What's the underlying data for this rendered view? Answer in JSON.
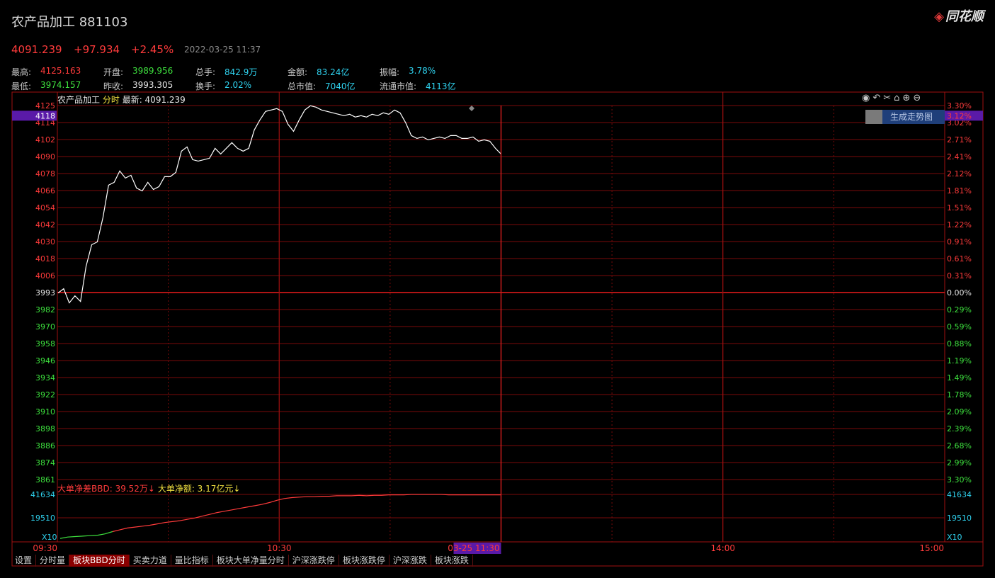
{
  "header": {
    "name": "农产品加工",
    "code": "881103",
    "logo": "同花顺",
    "price": "4091.239",
    "change": "+97.934",
    "pct": "+2.45%",
    "datetime": "2022-03-25 11:37"
  },
  "stats": {
    "high_label": "最高:",
    "high": "4125.163",
    "open_label": "开盘:",
    "open": "3989.956",
    "vol_label": "总手:",
    "vol": "842.9万",
    "amt_label": "金额:",
    "amt": "83.24亿",
    "amp_label": "振幅:",
    "amp": "3.78%",
    "low_label": "最低:",
    "low": "3974.157",
    "prev_label": "昨收:",
    "prev": "3993.305",
    "turn_label": "换手:",
    "turn": "2.02%",
    "mcap_label": "总市值:",
    "mcap": "7040亿",
    "fcap_label": "流通市值:",
    "fcap": "4113亿"
  },
  "chart": {
    "legend_name": "农产品加工",
    "legend_mode": "分时",
    "legend_latest": "最新: 4091.239",
    "cursor_price": "4118",
    "cursor_pct": "3.12%",
    "gen_button": "生成走势图",
    "icons": [
      "eye-icon",
      "undo-icon",
      "scissors-icon",
      "lock-icon",
      "zoom-in-icon",
      "zoom-out-icon"
    ],
    "bbd_label1": "大单净差BBD: 39.52万↓",
    "bbd_label2": "大单净额: 3.17亿元↓",
    "sub_multiplier": "X10",
    "cursor_time": "03-25 11:30"
  },
  "chart_data": {
    "type": "line",
    "title": "农产品加工 分时",
    "prev_close": 3993.305,
    "x_ticks": [
      "09:30",
      "10:30",
      "14:00",
      "15:00"
    ],
    "y_ticks_left": [
      "4125",
      "4114",
      "4102",
      "4090",
      "4078",
      "4066",
      "4054",
      "4042",
      "4030",
      "4018",
      "4006",
      "3993",
      "3982",
      "3970",
      "3958",
      "3946",
      "3934",
      "3922",
      "3910",
      "3898",
      "3886",
      "3874",
      "3861"
    ],
    "y_ticks_right": [
      "3.30%",
      "3.02%",
      "2.71%",
      "2.41%",
      "2.12%",
      "1.81%",
      "1.51%",
      "1.22%",
      "0.91%",
      "0.61%",
      "0.31%",
      "0.00%",
      "0.29%",
      "0.59%",
      "0.88%",
      "1.19%",
      "1.49%",
      "1.78%",
      "2.09%",
      "2.39%",
      "2.68%",
      "2.99%",
      "3.30%"
    ],
    "price_series": [
      3993,
      3996,
      3986,
      3991,
      3987,
      4012,
      4027,
      4029,
      4046,
      4069,
      4071,
      4079,
      4074,
      4076,
      4067,
      4065,
      4071,
      4066,
      4068,
      4075,
      4075,
      4078,
      4093,
      4096,
      4087,
      4086,
      4087,
      4088,
      4095,
      4091,
      4095,
      4099,
      4095,
      4093,
      4095,
      4108,
      4115,
      4121,
      4122,
      4123,
      4121,
      4112,
      4107,
      4115,
      4122,
      4125,
      4124,
      4122,
      4121,
      4120,
      4119,
      4118,
      4119,
      4117,
      4118,
      4117,
      4119,
      4118,
      4120,
      4119,
      4122,
      4120,
      4113,
      4104,
      4102,
      4103,
      4101,
      4102,
      4103,
      4102,
      4104,
      4104,
      4102,
      4102,
      4103,
      4100,
      4101,
      4100,
      4095,
      4091
    ],
    "sub_y_ticks": [
      "41634",
      "19510"
    ],
    "bbd_series": [
      0.03,
      0.06,
      0.07,
      0.08,
      0.09,
      0.1,
      0.13,
      0.18,
      0.22,
      0.26,
      0.28,
      0.3,
      0.32,
      0.35,
      0.38,
      0.4,
      0.42,
      0.45,
      0.48,
      0.52,
      0.56,
      0.6,
      0.63,
      0.66,
      0.69,
      0.72,
      0.75,
      0.78,
      0.82,
      0.87,
      0.91,
      0.93,
      0.94,
      0.95,
      0.95,
      0.96,
      0.96,
      0.97,
      0.97,
      0.97,
      0.98,
      0.97,
      0.98,
      0.98,
      0.99,
      0.99,
      0.99,
      1.0,
      1.0,
      1.0,
      1.0,
      1.0,
      0.99,
      0.99,
      0.99,
      0.99,
      0.99,
      0.99,
      0.99,
      0.99
    ]
  },
  "tabs": [
    "设置",
    "分时量",
    "板块BBD分时",
    "买卖力道",
    "量比指标",
    "板块大单净量分时",
    "沪深涨跌停",
    "板块涨跌停",
    "沪深涨跌",
    "板块涨跌"
  ],
  "active_tab": 2,
  "colors": {
    "up": "#ff3b3b",
    "down": "#3ee23e",
    "grid": "#7a0a0a",
    "frame": "#a01010",
    "line": "#ffffff"
  }
}
